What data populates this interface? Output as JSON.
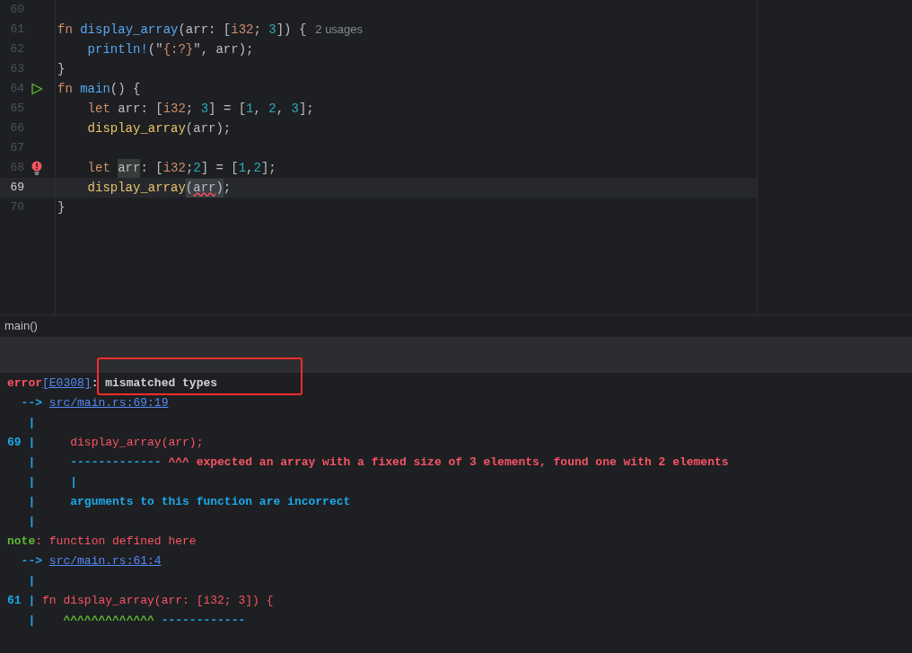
{
  "editor": {
    "lines": [
      {
        "number": "60",
        "current": false,
        "runnable": false,
        "error": false
      },
      {
        "number": "61",
        "current": false,
        "runnable": false,
        "error": false,
        "tokens": [
          {
            "kind": "keyword",
            "text": "fn "
          },
          {
            "kind": "fn-decl",
            "text": "display_array"
          },
          {
            "kind": "plain",
            "text": "(arr: ["
          },
          {
            "kind": "type",
            "text": "i32"
          },
          {
            "kind": "plain",
            "text": "; "
          },
          {
            "kind": "number",
            "text": "3"
          },
          {
            "kind": "plain",
            "text": "]) {"
          }
        ],
        "hint": "2 usages"
      },
      {
        "number": "62",
        "current": false,
        "runnable": false,
        "error": false,
        "tokens": [
          {
            "kind": "macro",
            "text": "    println!"
          },
          {
            "kind": "plain",
            "text": "(\""
          },
          {
            "kind": "format",
            "text": "{:?}"
          },
          {
            "kind": "plain",
            "text": "\", arr);"
          }
        ]
      },
      {
        "number": "63",
        "current": false,
        "runnable": false,
        "error": false,
        "tokens": [
          {
            "kind": "plain",
            "text": "}"
          }
        ]
      },
      {
        "number": "64",
        "current": false,
        "runnable": true,
        "error": false,
        "tokens": [
          {
            "kind": "keyword",
            "text": "fn "
          },
          {
            "kind": "fn-decl",
            "text": "main"
          },
          {
            "kind": "plain",
            "text": "() {"
          }
        ]
      },
      {
        "number": "65",
        "current": false,
        "runnable": false,
        "error": false,
        "tokens": [
          {
            "kind": "keyword",
            "text": "    let "
          },
          {
            "kind": "plain",
            "text": "arr: ["
          },
          {
            "kind": "type",
            "text": "i32"
          },
          {
            "kind": "plain",
            "text": "; "
          },
          {
            "kind": "number",
            "text": "3"
          },
          {
            "kind": "plain",
            "text": "] = ["
          },
          {
            "kind": "number",
            "text": "1"
          },
          {
            "kind": "plain",
            "text": ", "
          },
          {
            "kind": "number",
            "text": "2"
          },
          {
            "kind": "plain",
            "text": ", "
          },
          {
            "kind": "number",
            "text": "3"
          },
          {
            "kind": "plain",
            "text": "];"
          }
        ]
      },
      {
        "number": "66",
        "current": false,
        "runnable": false,
        "error": false,
        "tokens": [
          {
            "kind": "fn-call",
            "text": "    display_array"
          },
          {
            "kind": "plain",
            "text": "(arr);"
          }
        ]
      },
      {
        "number": "67",
        "current": false,
        "runnable": false,
        "error": false
      },
      {
        "number": "68",
        "current": false,
        "runnable": false,
        "error": true,
        "tokens": [
          {
            "kind": "keyword",
            "text": "    let "
          },
          {
            "kind": "usage",
            "text": "arr"
          },
          {
            "kind": "plain",
            "text": ": ["
          },
          {
            "kind": "type",
            "text": "i32"
          },
          {
            "kind": "plain",
            "text": ";"
          },
          {
            "kind": "number",
            "text": "2"
          },
          {
            "kind": "plain",
            "text": "] = ["
          },
          {
            "kind": "number",
            "text": "1"
          },
          {
            "kind": "plain",
            "text": ","
          },
          {
            "kind": "number",
            "text": "2"
          },
          {
            "kind": "plain",
            "text": "];"
          }
        ]
      },
      {
        "number": "69",
        "current": true,
        "runnable": false,
        "error": false,
        "tokens": [
          {
            "kind": "fn-call",
            "text": "    display_array"
          },
          {
            "kind": "brace-match",
            "text": "("
          },
          {
            "kind": "error-usage",
            "text": "arr"
          },
          {
            "kind": "brace-match",
            "text": ")"
          },
          {
            "kind": "plain",
            "text": ";"
          }
        ]
      },
      {
        "number": "70",
        "current": false,
        "runnable": false,
        "error": false,
        "tokens": [
          {
            "kind": "plain",
            "text": "}"
          }
        ]
      }
    ]
  },
  "breadcrumb": "main()",
  "console": {
    "lines": [
      [
        {
          "kind": "error-label",
          "text": "error"
        },
        {
          "kind": "link",
          "text": "[E0308]"
        },
        {
          "kind": "message",
          "text": ": mismatched types"
        }
      ],
      [
        {
          "kind": "arrow",
          "text": "  --> "
        },
        {
          "kind": "link",
          "text": "src/main.rs:69:19"
        }
      ],
      [
        {
          "kind": "gutter",
          "text": "   |"
        }
      ],
      [
        {
          "kind": "gutter",
          "text": "69 |"
        },
        {
          "kind": "source",
          "text": "     display_array(arr);"
        }
      ],
      [
        {
          "kind": "gutter",
          "text": "   |"
        },
        {
          "kind": "secondary",
          "text": "     ------------- "
        },
        {
          "kind": "primary",
          "text": "^^^ expected an array with a fixed size of 3 elements, found one with 2 elements"
        }
      ],
      [
        {
          "kind": "gutter",
          "text": "   |"
        },
        {
          "kind": "secondary",
          "text": "     |"
        }
      ],
      [
        {
          "kind": "gutter",
          "text": "   |"
        },
        {
          "kind": "secondary",
          "text": "     arguments to this function are incorrect"
        }
      ],
      [
        {
          "kind": "gutter",
          "text": "   |"
        }
      ],
      [
        {
          "kind": "note-label",
          "text": "note"
        },
        {
          "kind": "source",
          "text": ": function defined here"
        }
      ],
      [
        {
          "kind": "arrow",
          "text": "  --> "
        },
        {
          "kind": "link",
          "text": "src/main.rs:61:4"
        }
      ],
      [
        {
          "kind": "gutter",
          "text": "   |"
        }
      ],
      [
        {
          "kind": "gutter",
          "text": "61 |"
        },
        {
          "kind": "source",
          "text": " fn display_array(arr: [i32; 3]) {"
        }
      ],
      [
        {
          "kind": "gutter",
          "text": "   |"
        },
        {
          "kind": "caret",
          "text": "    ^^^^^^^^^^^^^ "
        },
        {
          "kind": "secondary",
          "text": "------------"
        }
      ]
    ]
  }
}
